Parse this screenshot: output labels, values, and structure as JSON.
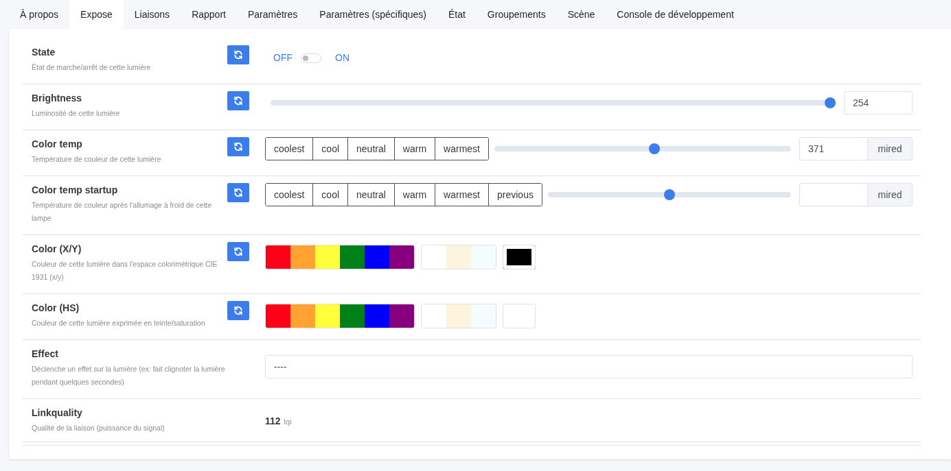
{
  "tabs": [
    {
      "label": "À propos",
      "selected": false
    },
    {
      "label": "Expose",
      "selected": true
    },
    {
      "label": "Liaisons",
      "selected": false
    },
    {
      "label": "Rapport",
      "selected": false
    },
    {
      "label": "Paramètres",
      "selected": false
    },
    {
      "label": "Paramètres (spécifiques)",
      "selected": false
    },
    {
      "label": "État",
      "selected": false
    },
    {
      "label": "Groupements",
      "selected": false
    },
    {
      "label": "Scène",
      "selected": false
    },
    {
      "label": "Console de développement",
      "selected": false
    }
  ],
  "features": [
    {
      "kind": "toggle",
      "title": "State",
      "description": "État de marche/arrêt de cette lumière",
      "refresh": true,
      "off_label": "OFF",
      "on_label": "ON",
      "on": false
    },
    {
      "kind": "slider",
      "title": "Brightness",
      "description": "Luminosité de cette lumière",
      "refresh": true,
      "level": 1,
      "value": "254"
    },
    {
      "kind": "preset_slider",
      "title": "Color temp",
      "description": "Température de couleur de cette lumière",
      "refresh": true,
      "presets": [
        "coolest",
        "cool",
        "neutral",
        "warm",
        "warmest"
      ],
      "level": 0.54,
      "value": "371",
      "unit": "mired"
    },
    {
      "kind": "preset_slider",
      "title": "Color temp startup",
      "description": "Température de couleur après l'allumage à froid de cette lampe",
      "refresh": true,
      "presets": [
        "coolest",
        "cool",
        "neutral",
        "warm",
        "warmest",
        "previous"
      ],
      "level": 0.5,
      "unit": "mired"
    },
    {
      "kind": "color",
      "title": "Color (X/Y)",
      "description": "Couleur de cette lumière dans l'espace colorimétrique CIE 1931 (x/y)",
      "refresh": true,
      "swatches": [
        {
          "color": "#ff0019"
        },
        {
          "color": "#ffa230"
        },
        {
          "color": "#ffff3c"
        },
        {
          "color": "#008018"
        },
        {
          "color": "#0000f9"
        },
        {
          "color": "#86007d"
        }
      ],
      "whites": [
        {
          "color": "#ffffff"
        },
        {
          "color": "#fcf4dc"
        },
        {
          "color": "#f5fcfe"
        }
      ],
      "picker": {
        "color": "#000000"
      }
    },
    {
      "kind": "color",
      "title": "Color (HS)",
      "description": "Couleur de cette lumière exprimée en teinte/saturation",
      "refresh": true,
      "swatches": [
        {
          "color": "#ff0019"
        },
        {
          "color": "#ffa230"
        },
        {
          "color": "#ffff3c"
        },
        {
          "color": "#008018"
        },
        {
          "color": "#0000f9"
        },
        {
          "color": "#86007d"
        }
      ],
      "whites": [
        {
          "color": "#ffffff"
        },
        {
          "color": "#fcf4dc"
        },
        {
          "color": "#f5fcfe"
        }
      ],
      "picker": {
        "color": "#ffffff"
      }
    },
    {
      "kind": "select",
      "title": "Effect",
      "description": "Déclenche un effet sur la lumière (ex: fait clignoter la lumière pendant quelques secondes)",
      "refresh": false,
      "value": "----"
    },
    {
      "kind": "reading",
      "title": "Linkquality",
      "description": "Qualité de la liaison (puissance du signal)",
      "refresh": false,
      "value": "112",
      "unit": "lqi"
    }
  ]
}
